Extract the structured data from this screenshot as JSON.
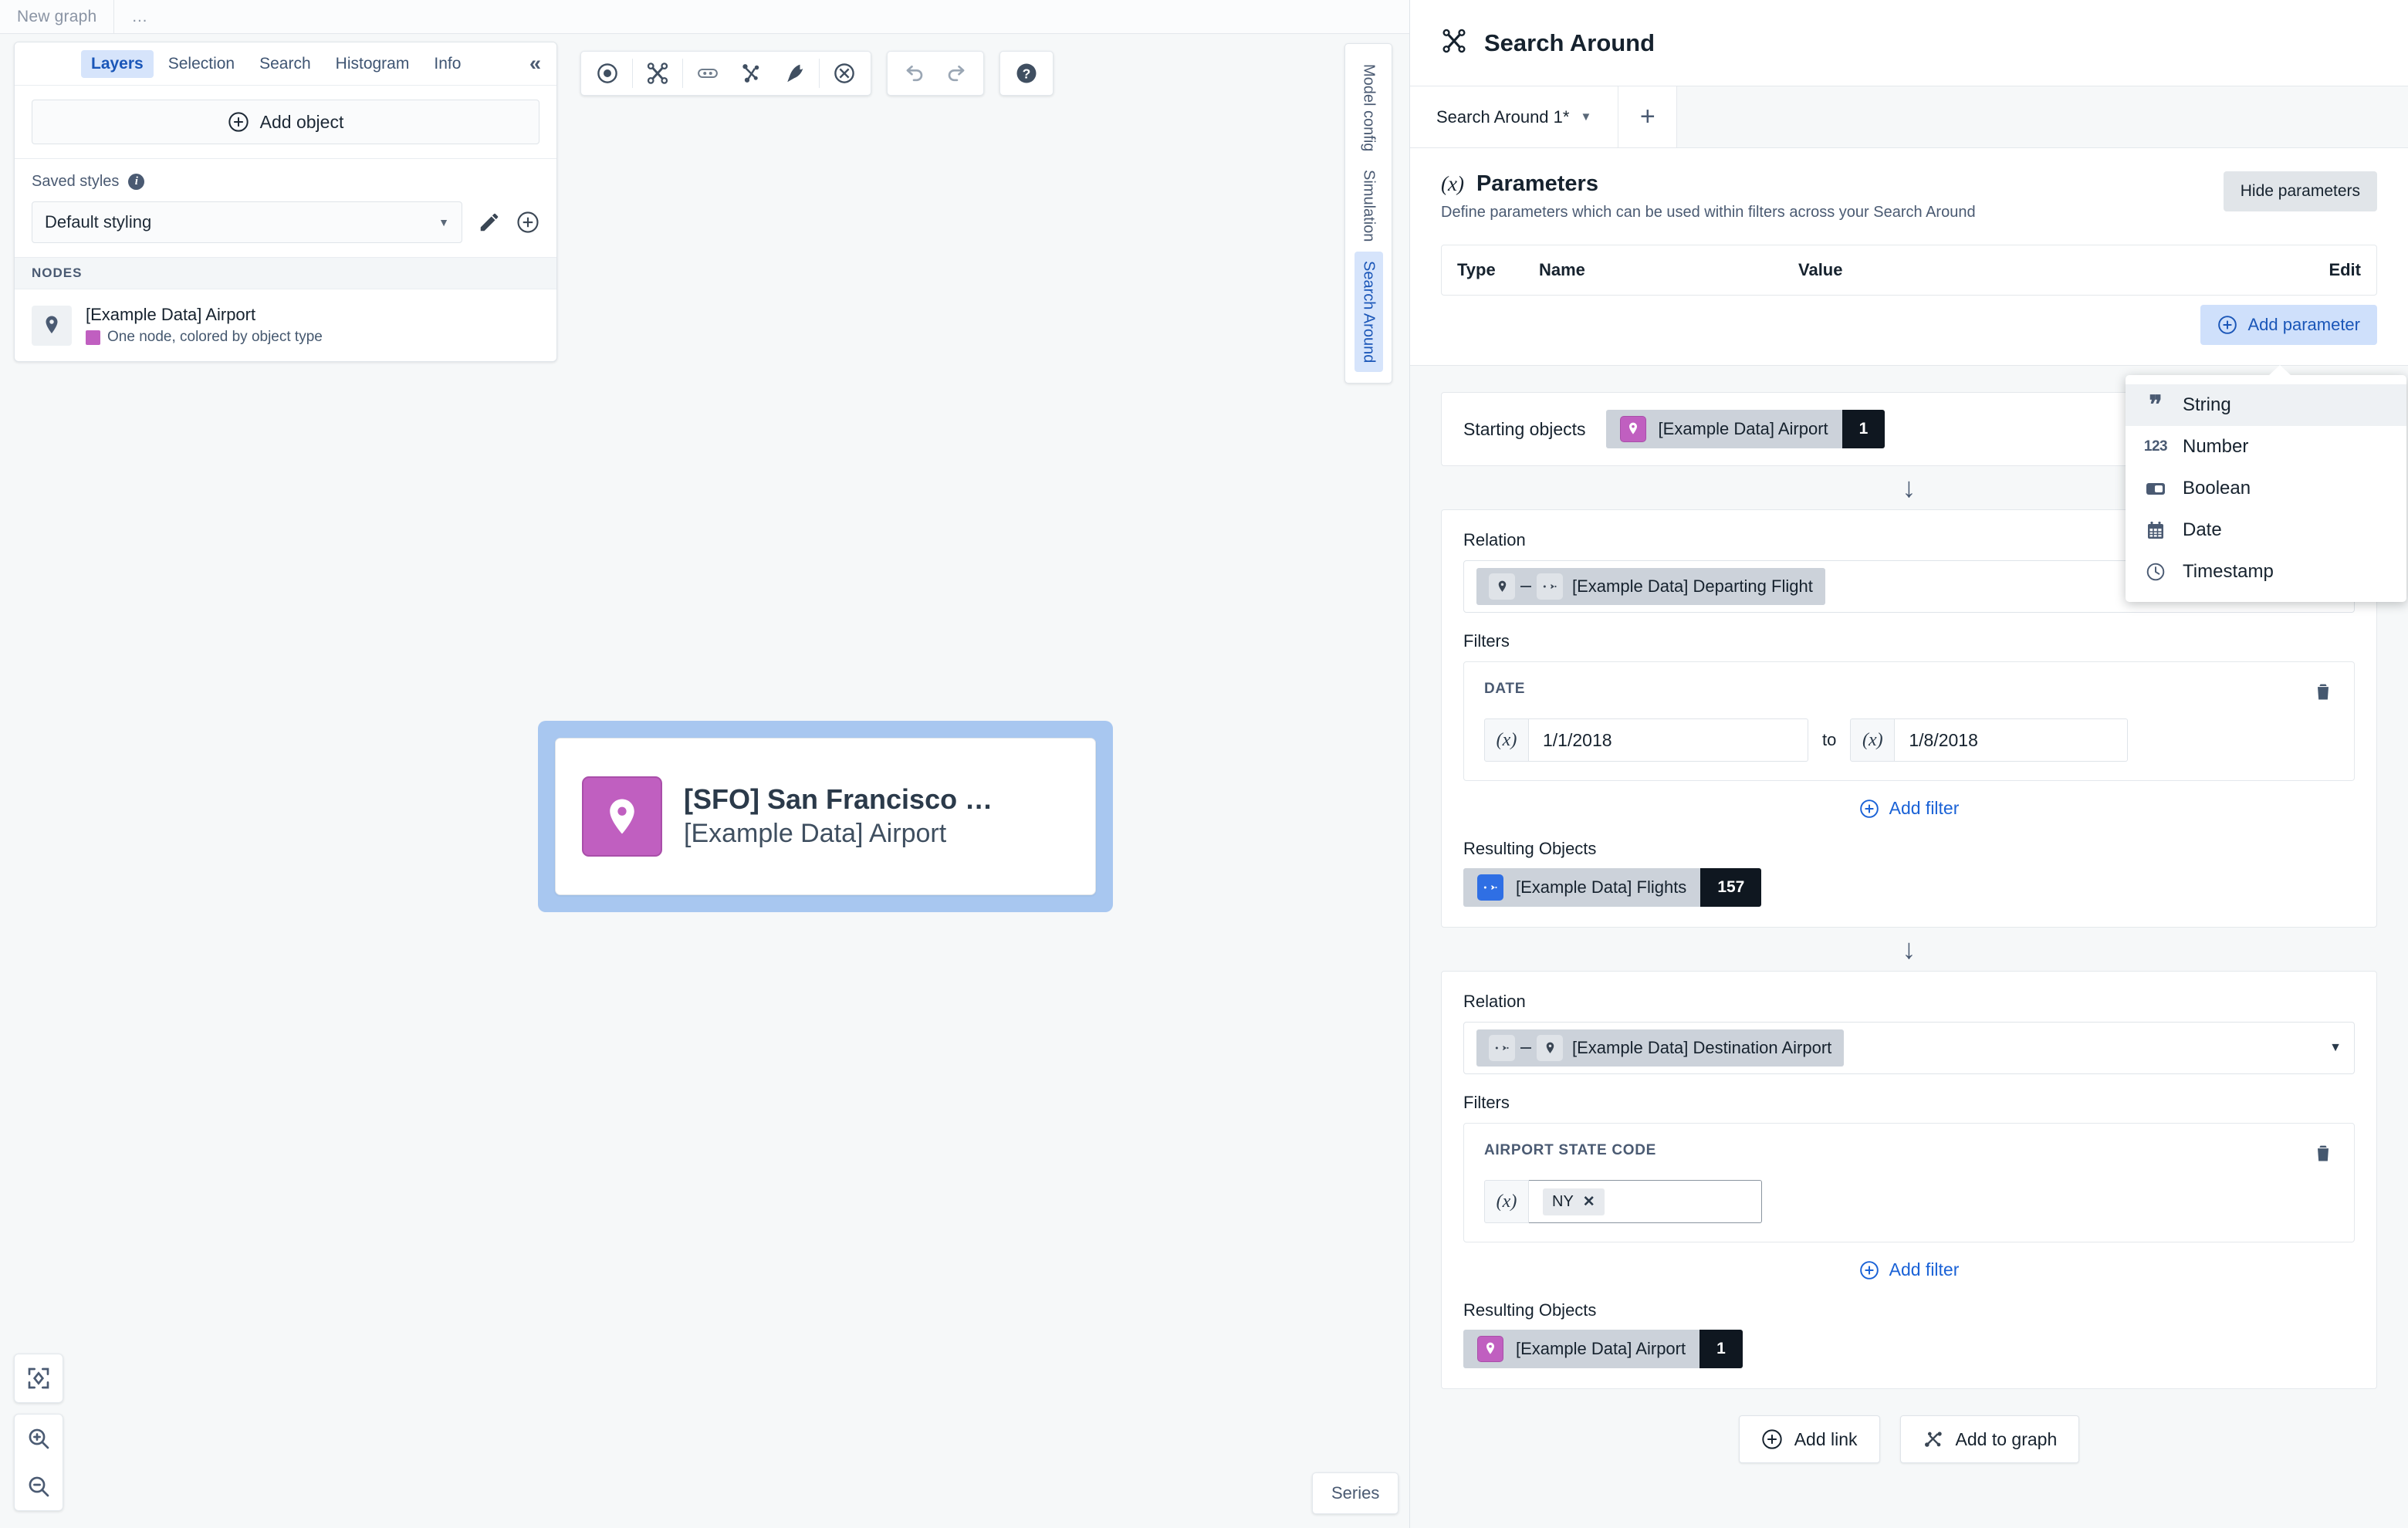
{
  "topbar": {
    "graph_name": "New graph",
    "more": "…"
  },
  "left_panel": {
    "tabs": [
      {
        "label": "Layers",
        "active": true
      },
      {
        "label": "Selection",
        "active": false
      },
      {
        "label": "Search",
        "active": false
      },
      {
        "label": "Histogram",
        "active": false
      },
      {
        "label": "Info",
        "active": false
      }
    ],
    "collapse_icon": "«",
    "add_object_label": "Add object",
    "saved_styles_label": "Saved styles",
    "style_value": "Default styling",
    "nodes_header": "NODES",
    "node": {
      "title": "[Example Data] Airport",
      "subtitle": "One node, colored by object type",
      "swatch_color": "#c05fc0"
    }
  },
  "graph_toolbar": {
    "buttons": [
      "select-icon",
      "search-around-icon",
      "link-icon",
      "expand-icon",
      "pen-icon",
      "delete-icon",
      "undo-icon",
      "redo-icon",
      "help-icon"
    ]
  },
  "vertical_tabs": [
    {
      "label": "Model config",
      "active": false
    },
    {
      "label": "Simulation",
      "active": false
    },
    {
      "label": "Search Around",
      "active": true
    }
  ],
  "graph_node": {
    "title": "[SFO] San Francisco …",
    "subtitle": "[Example Data] Airport",
    "icon_color": "#c05fc0",
    "selection_color": "#a8c7f0"
  },
  "canvas_controls": {
    "fit_label": "fit-to-screen-icon",
    "zoom_in_label": "zoom-in-icon",
    "zoom_out_label": "zoom-out-icon",
    "series_label": "Series"
  },
  "right_panel": {
    "title": "Search Around",
    "tab": {
      "label": "Search Around 1*"
    },
    "add_tab": "+",
    "parameters": {
      "heading": "Parameters",
      "glyph": "(x)",
      "description": "Define parameters which can be used within filters across your Search Around",
      "hide_label": "Hide parameters",
      "columns": {
        "type": "Type",
        "name": "Name",
        "value": "Value",
        "edit": "Edit"
      },
      "add_label": "Add parameter"
    },
    "starting_objects": {
      "label": "Starting objects",
      "chip_label": "[Example Data] Airport",
      "chip_count": "1"
    },
    "steps": [
      {
        "relation_label": "Relation",
        "relation_value": "[Example Data] Departing Flight",
        "filters_label": "Filters",
        "filter_name": "DATE",
        "from_value": "1/1/2018",
        "to_word": "to",
        "to_value": "1/8/2018",
        "fx": "(x)",
        "add_filter_label": "Add filter",
        "results_label": "Resulting Objects",
        "result_chip": "[Example Data] Flights",
        "result_count": "157"
      },
      {
        "relation_label": "Relation",
        "relation_value": "[Example Data] Destination Airport",
        "filters_label": "Filters",
        "filter_name": "AIRPORT STATE CODE",
        "tag_value": "NY",
        "fx": "(x)",
        "add_filter_label": "Add filter",
        "results_label": "Resulting Objects",
        "result_chip": "[Example Data] Airport",
        "result_count": "1"
      }
    ],
    "actions": {
      "add_link": "Add link",
      "add_to_graph": "Add to graph"
    }
  },
  "type_menu": {
    "items": [
      {
        "label": "String",
        "icon": "quote-icon",
        "highlighted": true
      },
      {
        "label": "Number",
        "icon": "number-icon",
        "highlighted": false
      },
      {
        "label": "Boolean",
        "icon": "boolean-icon",
        "highlighted": false
      },
      {
        "label": "Date",
        "icon": "calendar-icon",
        "highlighted": false
      },
      {
        "label": "Timestamp",
        "icon": "clock-icon",
        "highlighted": false
      }
    ]
  }
}
